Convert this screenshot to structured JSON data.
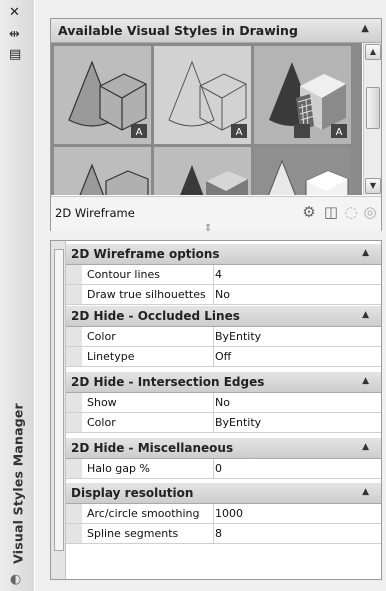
{
  "palette": {
    "sidebar": {
      "title": "Visual Styles Manager",
      "close_glyph": "✕",
      "autohide_glyph": "⇹",
      "properties_glyph": "▤",
      "bottom_glyph": "◐"
    },
    "styles": {
      "title": "Available Visual Styles in Drawing",
      "collapse_glyph": "▲",
      "scroll_up_glyph": "▲",
      "scroll_down_glyph": "▼",
      "current_style": "2D Wireframe",
      "thumbnail_badge": "A",
      "tools": {
        "create_glyph": "⚙",
        "apply_glyph": "◫",
        "export_glyph": "◌",
        "delete_glyph": "◎"
      },
      "splitter_glyph": "⇕"
    },
    "properties": {
      "sections": [
        {
          "title": "2D Wireframe options",
          "collapse_glyph": "▲",
          "rows": [
            {
              "label": "Contour lines",
              "value": "4"
            },
            {
              "label": "Draw true silhouettes",
              "value": "No"
            }
          ]
        },
        {
          "title": "2D Hide - Occluded Lines",
          "collapse_glyph": "▲",
          "rows": [
            {
              "label": "Color",
              "value": "ByEntity"
            },
            {
              "label": "Linetype",
              "value": "Off"
            }
          ]
        },
        {
          "title": "2D Hide - Intersection Edges",
          "collapse_glyph": "▲",
          "rows": [
            {
              "label": "Show",
              "value": "No"
            },
            {
              "label": "Color",
              "value": "ByEntity"
            }
          ]
        },
        {
          "title": "2D Hide - Miscellaneous",
          "collapse_glyph": "▲",
          "rows": [
            {
              "label": "Halo gap %",
              "value": "0"
            }
          ]
        },
        {
          "title": "Display resolution",
          "collapse_glyph": "▲",
          "rows": [
            {
              "label": "Arc/circle smoothing",
              "value": "1000"
            },
            {
              "label": "Spline segments",
              "value": "8"
            }
          ]
        }
      ]
    }
  }
}
